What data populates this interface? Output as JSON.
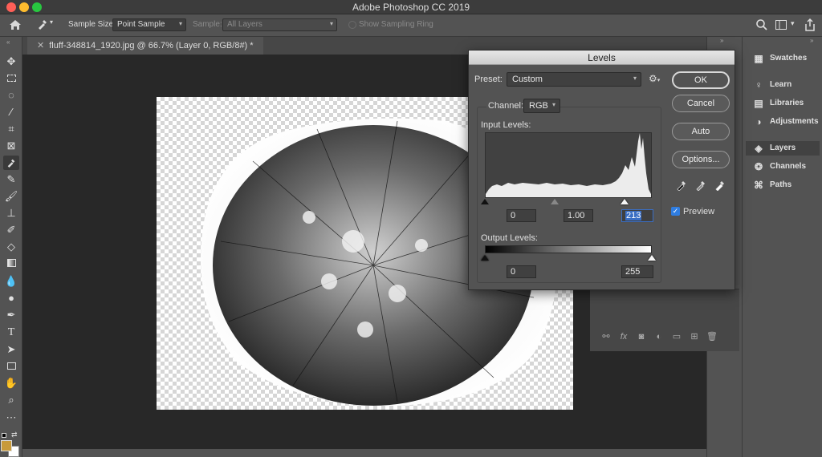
{
  "app": {
    "title": "Adobe Photoshop CC 2019"
  },
  "options_bar": {
    "sample_size_label": "Sample Size:",
    "sample_size_value": "Point Sample",
    "sample_label": "Sample:",
    "sample_value": "All Layers",
    "show_ring_label": "Show Sampling Ring"
  },
  "document": {
    "tab_title": "fluff-348814_1920.jpg @ 66.7% (Layer 0, RGB/8#) *"
  },
  "toolbar": {
    "icons": [
      "move-tool-icon",
      "marquee-tool-icon",
      "lasso-tool-icon",
      "magic-wand-tool-icon",
      "crop-tool-icon",
      "frame-tool-icon",
      "eyedropper-tool-icon",
      "healing-brush-tool-icon",
      "brush-tool-icon",
      "clone-stamp-tool-icon",
      "history-brush-tool-icon",
      "eraser-tool-icon",
      "gradient-tool-icon",
      "blur-tool-icon",
      "dodge-tool-icon",
      "pen-tool-icon",
      "type-tool-icon",
      "path-selection-tool-icon",
      "rectangle-tool-icon",
      "hand-tool-icon",
      "zoom-tool-icon",
      "more-tools-icon"
    ],
    "foreground_color": "#c89a3a",
    "background_color": "#ffffff"
  },
  "right_panel": {
    "items": [
      {
        "label": "Swatches",
        "icon": "grid-icon"
      },
      {
        "label": "Learn",
        "icon": "lightbulb-icon"
      },
      {
        "label": "Libraries",
        "icon": "library-icon"
      },
      {
        "label": "Adjustments",
        "icon": "adjust-circle-icon"
      },
      {
        "label": "Layers",
        "icon": "layers-icon"
      },
      {
        "label": "Channels",
        "icon": "channels-icon"
      },
      {
        "label": "Paths",
        "icon": "paths-icon"
      }
    ]
  },
  "levels_dialog": {
    "title": "Levels",
    "preset_label": "Preset:",
    "preset_value": "Custom",
    "channel_label": "Channel:",
    "channel_value": "RGB",
    "input_levels_label": "Input Levels:",
    "input_black": "0",
    "input_gamma": "1.00",
    "input_white": "213",
    "output_levels_label": "Output Levels:",
    "output_black": "0",
    "output_white": "255",
    "buttons": {
      "ok": "OK",
      "cancel": "Cancel",
      "auto": "Auto",
      "options": "Options..."
    },
    "preview_label": "Preview",
    "preview_checked": true,
    "input_slider_levels": {
      "black": 0,
      "gamma": 1.0,
      "white": 213
    },
    "output_slider_levels": {
      "black": 0,
      "white": 255
    }
  }
}
